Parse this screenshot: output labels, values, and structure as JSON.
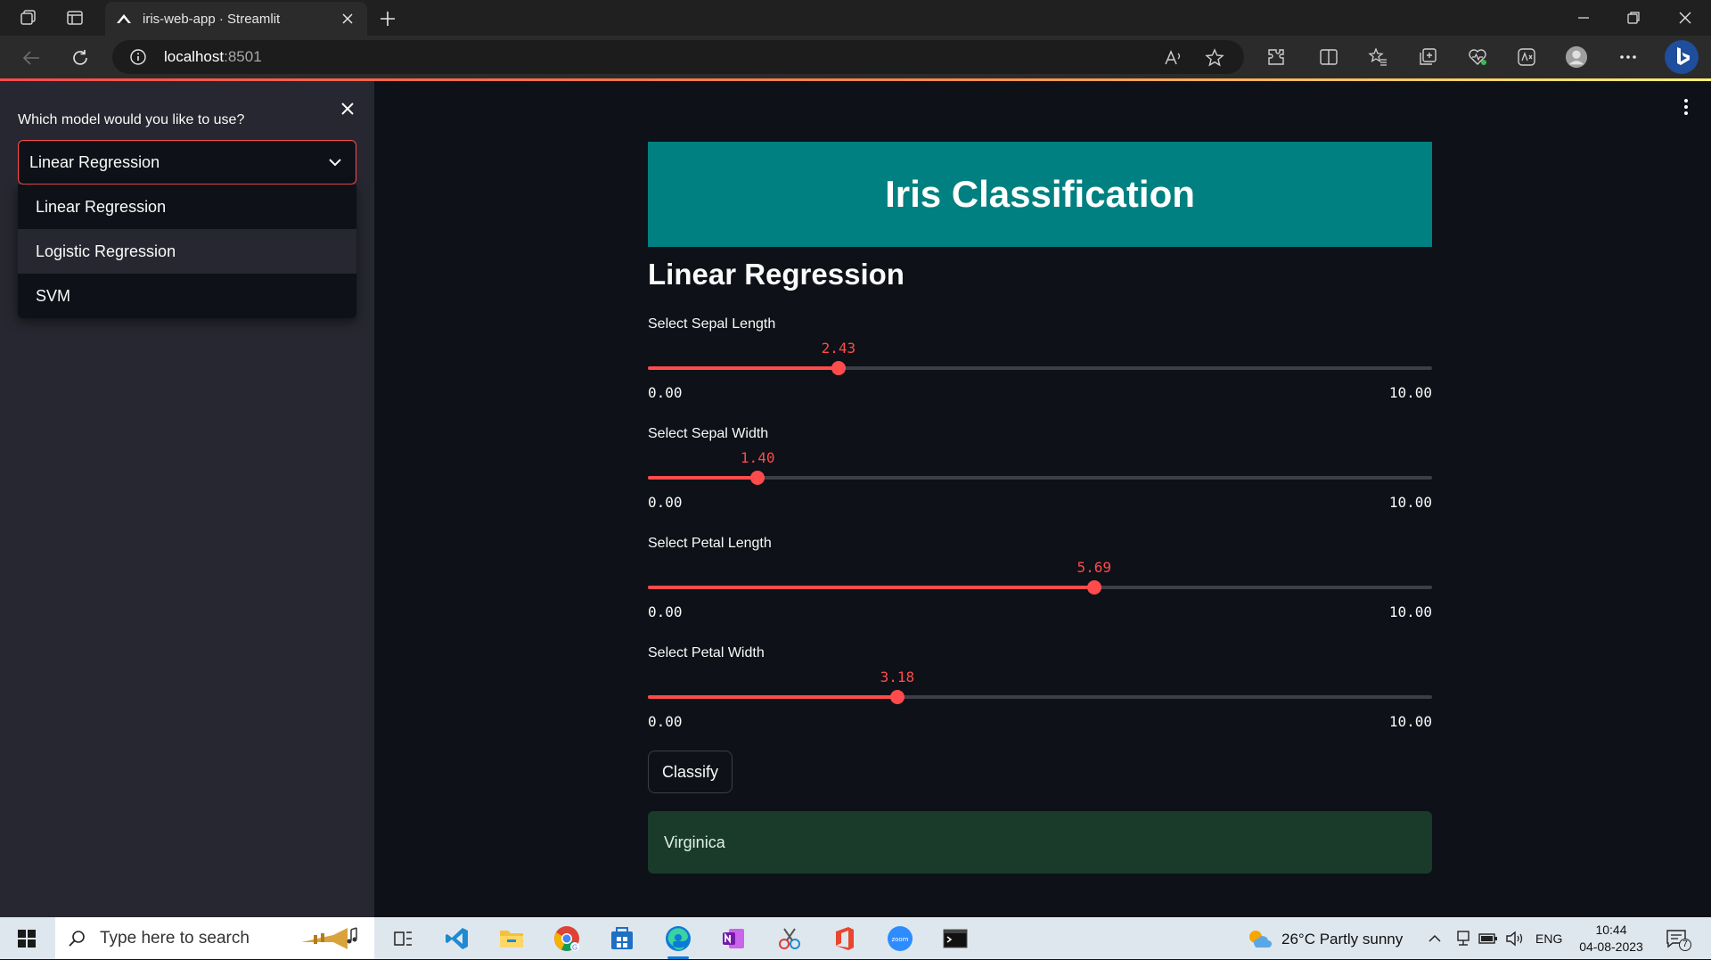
{
  "browser": {
    "tab_title": "iris-web-app · Streamlit",
    "url_host": "localhost",
    "url_port": ":8501",
    "read_aloud_label": "A⁾"
  },
  "sidebar": {
    "select_label": "Which model would you like to use?",
    "selected_model": "Linear Regression",
    "options": [
      "Linear Regression",
      "Logistic Regression",
      "SVM"
    ],
    "hovered_option": "Logistic Regression"
  },
  "main": {
    "title": "Iris Classification",
    "subheader": "Linear Regression",
    "sliders": [
      {
        "label": "Select Sepal Length",
        "value": "2.43",
        "min": "0.00",
        "max": "10.00",
        "fraction": 0.243
      },
      {
        "label": "Select Sepal Width",
        "value": "1.40",
        "min": "0.00",
        "max": "10.00",
        "fraction": 0.14
      },
      {
        "label": "Select Petal Length",
        "value": "5.69",
        "min": "0.00",
        "max": "10.00",
        "fraction": 0.569
      },
      {
        "label": "Select Petal Width",
        "value": "3.18",
        "min": "0.00",
        "max": "10.00",
        "fraction": 0.318
      }
    ],
    "classify_label": "Classify",
    "result": "Virginica"
  },
  "taskbar": {
    "search_placeholder": "Type here to search",
    "weather": "26°C  Partly sunny",
    "language": "ENG",
    "time": "10:44",
    "date": "04-08-2023",
    "notification_count": "7"
  },
  "colors": {
    "accent": "#ff4b4b",
    "banner": "#008080",
    "result_bg": "#1a3a2a",
    "sidebar_bg": "#262730",
    "app_bg": "#0e1117"
  }
}
